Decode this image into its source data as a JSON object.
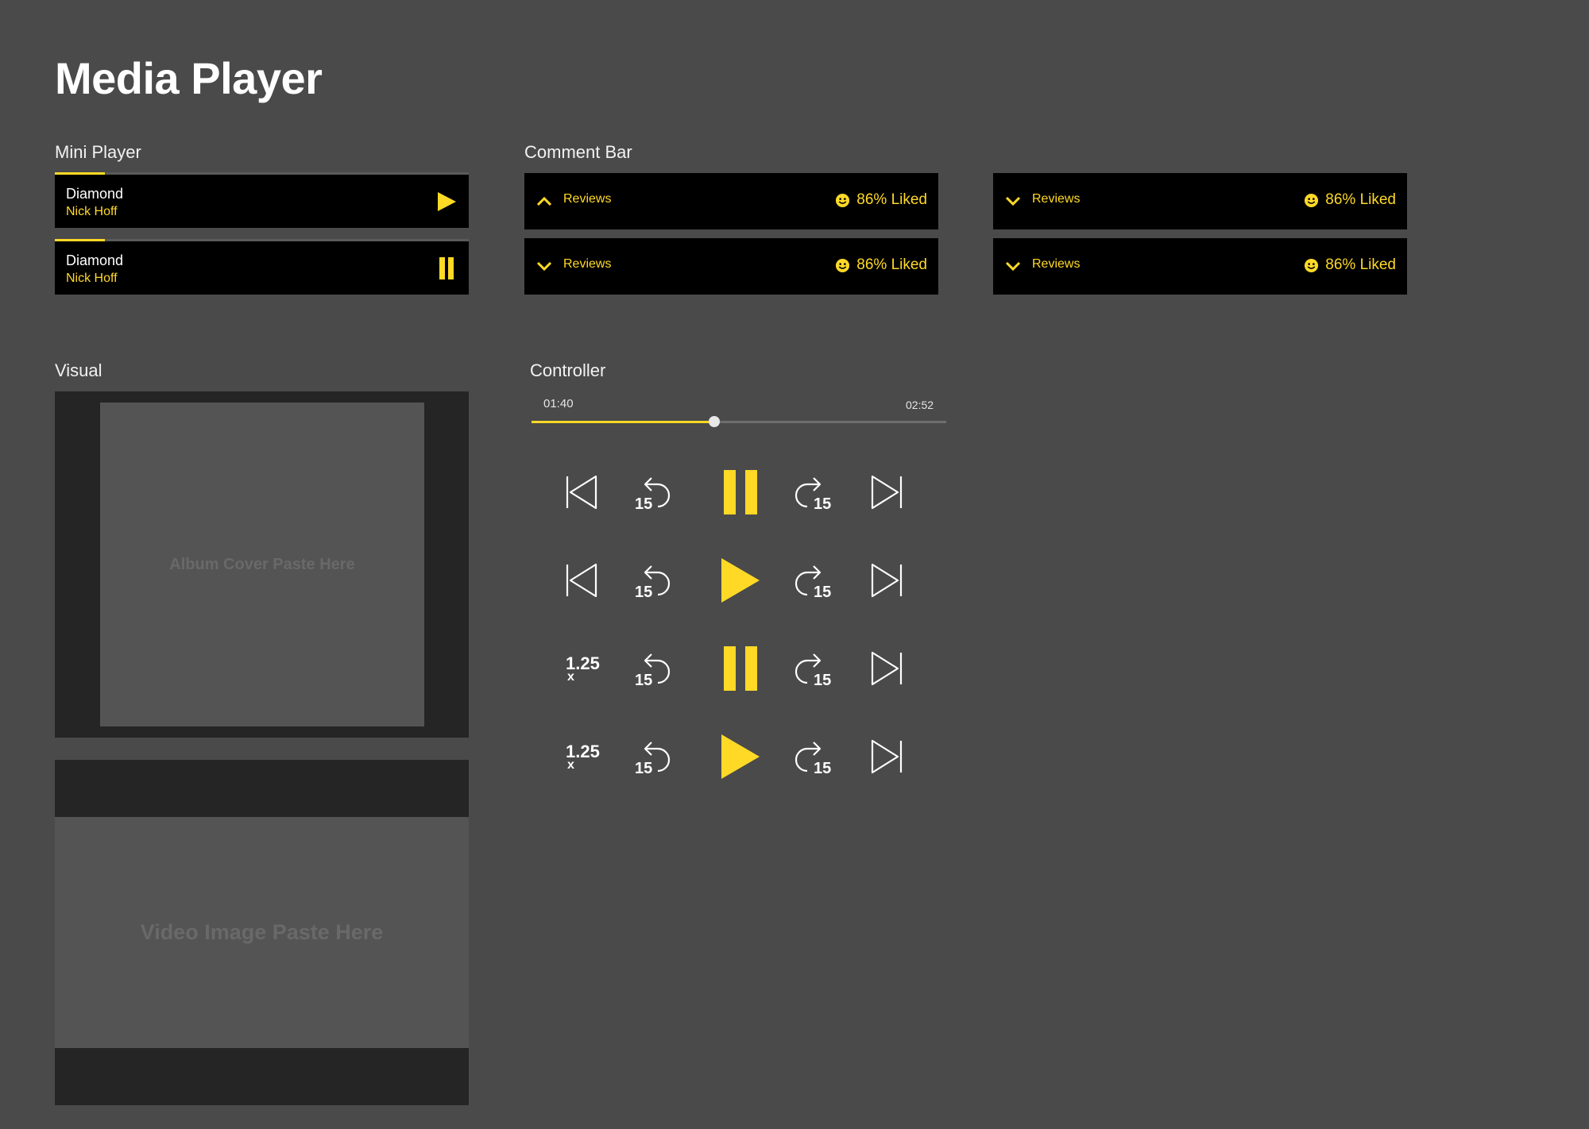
{
  "page": {
    "title": "Media Player"
  },
  "colors": {
    "accent": "#ffd926",
    "background": "#4a4a4a",
    "bar": "#000000",
    "panel_dark": "#252525",
    "panel_mid": "#545454"
  },
  "mini_player": {
    "label": "Mini Player",
    "items": [
      {
        "song": "Diamond",
        "artist": "Nick Hoff",
        "state": "paused",
        "button_icon": "play-icon",
        "progress": 0.12
      },
      {
        "song": "Diamond",
        "artist": "Nick Hoff",
        "state": "playing",
        "button_icon": "pause-icon",
        "progress": 0.12
      }
    ]
  },
  "comment_bar": {
    "label": "Comment Bar",
    "bars": [
      {
        "reviews": "Reviews",
        "liked": "86% Liked",
        "chevron": "chevron-up-icon",
        "emoji": "smiley-icon"
      },
      {
        "reviews": "Reviews",
        "liked": "86% Liked",
        "chevron": "chevron-down-icon",
        "emoji": "smiley-icon"
      },
      {
        "reviews": "Reviews",
        "liked": "86% Liked",
        "chevron": "chevron-down-icon",
        "emoji": "smiley-icon"
      },
      {
        "reviews": "Reviews",
        "liked": "86% Liked",
        "chevron": "chevron-down-icon",
        "emoji": "smiley-icon"
      }
    ]
  },
  "visual": {
    "label": "Visual",
    "album_placeholder": "Album Cover Paste Here",
    "video_placeholder": "Video Image Paste Here"
  },
  "controller": {
    "label": "Controller",
    "current_time": "01:40",
    "total_time": "02:52",
    "progress": 0.44,
    "rewind_seconds": "15",
    "forward_seconds": "15",
    "speed_value": "1.25",
    "speed_suffix": "x",
    "rows": [
      {
        "left": "skip-previous-icon",
        "center": "pause-icon"
      },
      {
        "left": "skip-previous-icon",
        "center": "play-icon"
      },
      {
        "left": "playback-speed",
        "center": "pause-icon"
      },
      {
        "left": "playback-speed",
        "center": "play-icon"
      }
    ]
  }
}
